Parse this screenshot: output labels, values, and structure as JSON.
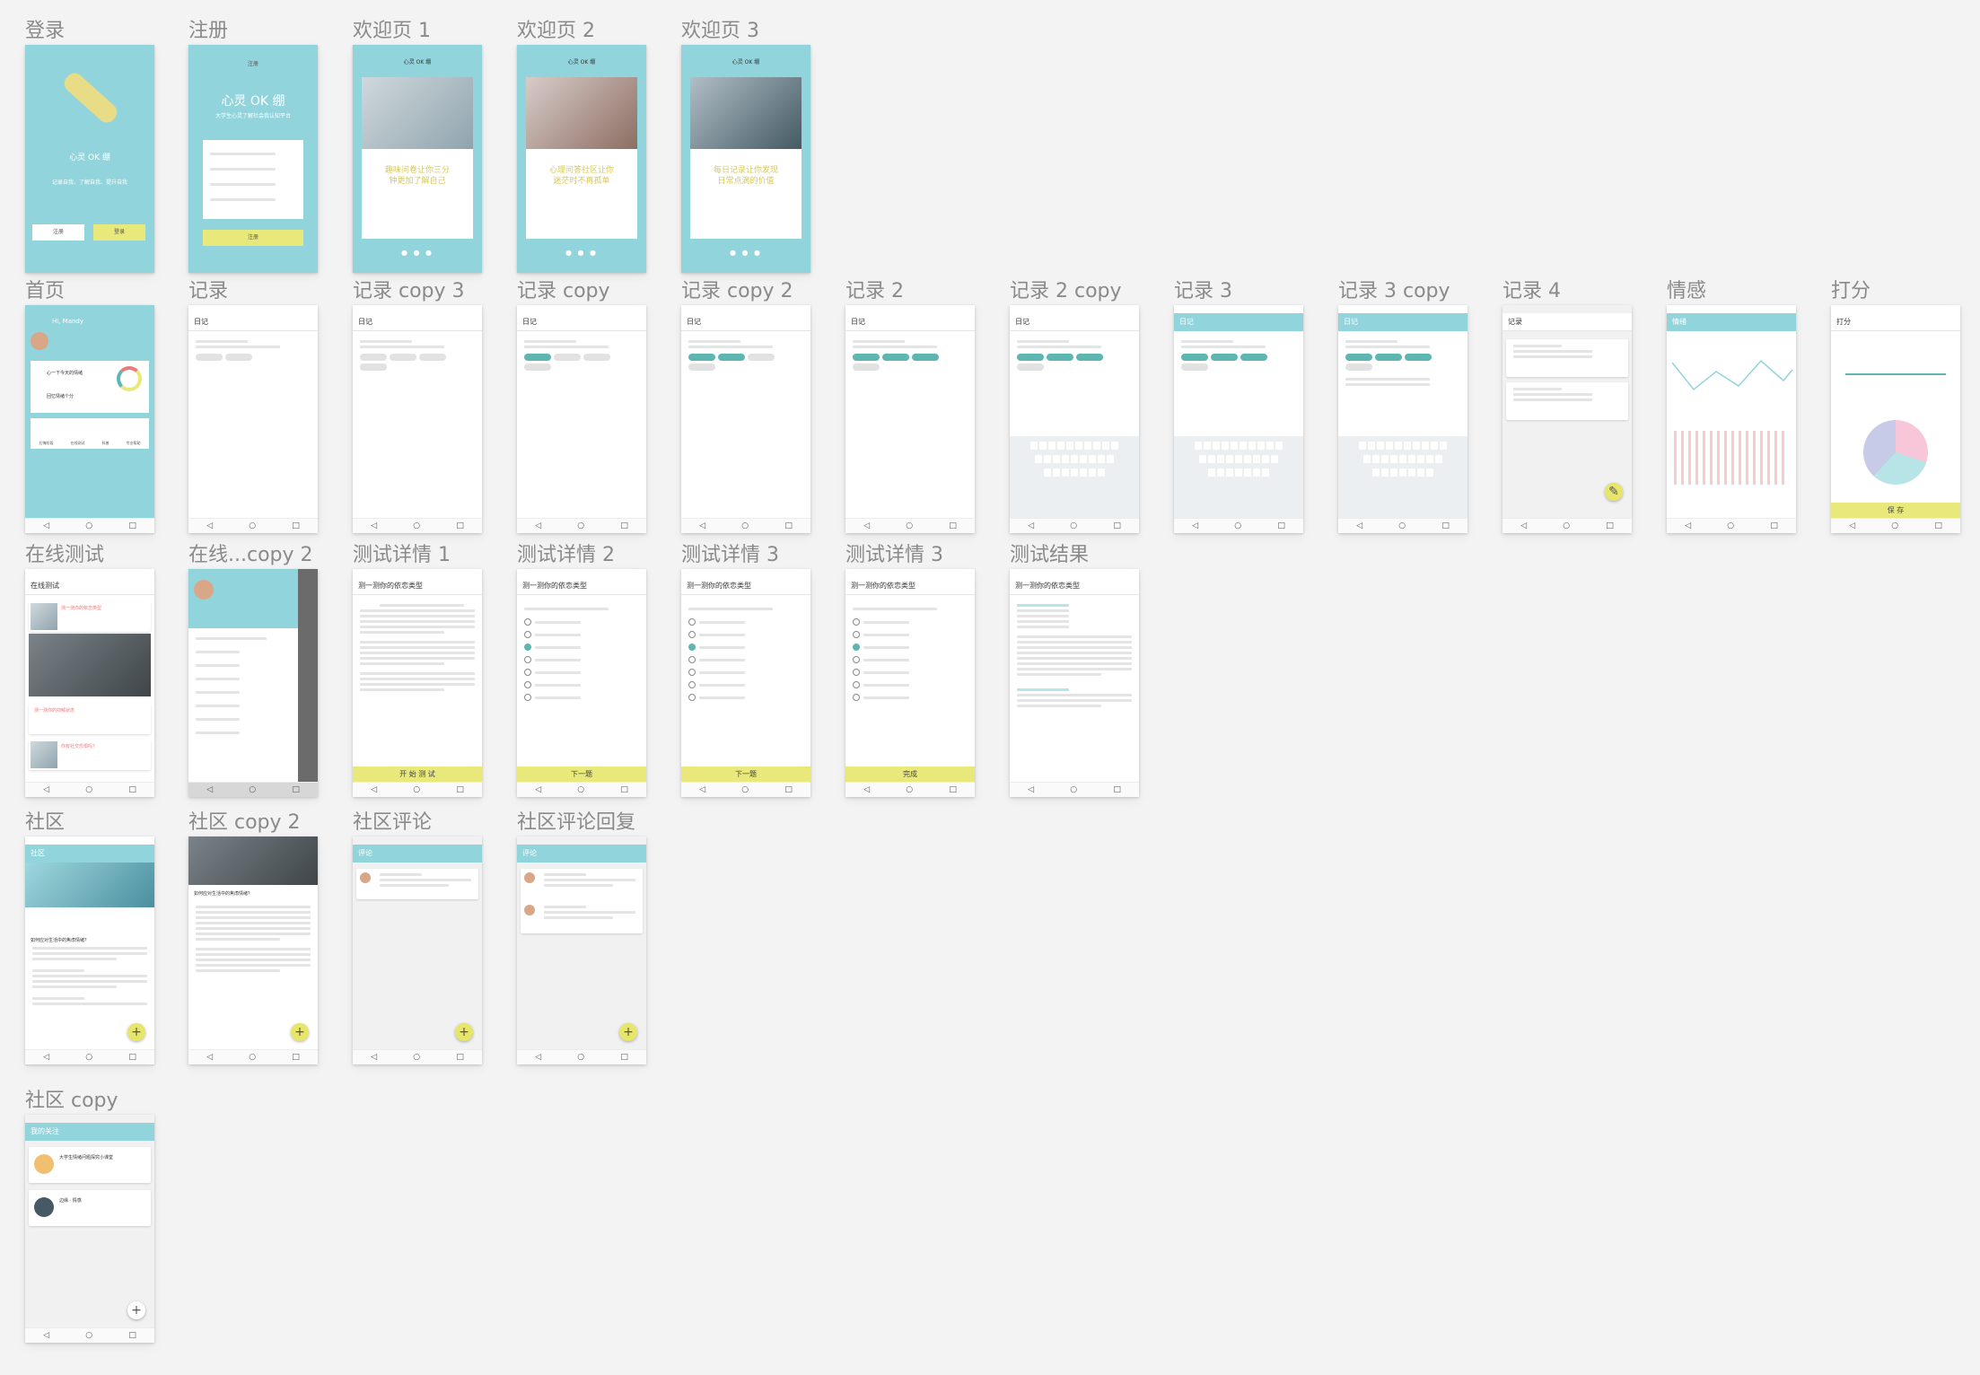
{
  "boards": {
    "login": "登录",
    "signup": "注册",
    "welcome1": "欢迎页 1",
    "welcome2": "欢迎页 2",
    "welcome3": "欢迎页 3",
    "home": "首页",
    "record": "记录",
    "record_copy3": "记录 copy 3",
    "record_copy": "记录 copy",
    "record_copy2": "记录 copy 2",
    "record2": "记录 2",
    "record2_copy": "记录 2 copy",
    "record3": "记录 3",
    "record3_copy": "记录 3 copy",
    "record4": "记录 4",
    "emotion": "情感",
    "rating": "打分",
    "online_test": "在线测试",
    "online_test_copy2": "在线...copy 2",
    "test_detail1": "测试详情 1",
    "test_detail2": "测试详情 2",
    "test_detail3a": "测试详情 3",
    "test_detail3b": "测试详情 3",
    "test_result": "测试结果",
    "community": "社区",
    "community_copy2": "社区 copy 2",
    "community_comment": "社区评论",
    "community_reply": "社区评论回复",
    "community_copy": "社区 copy"
  },
  "login": {
    "app_name": "心灵 OK 绷",
    "slogan": "记录自我、了解自我、提升自我",
    "btn_signup": "注册",
    "btn_login": "登录"
  },
  "signup": {
    "header": "注册",
    "title": "心灵 OK 绷",
    "subtitle": "大学生心灵了解社会我认知平台",
    "btn": "注册"
  },
  "welcome": {
    "header": "心灵 OK 绷",
    "w1": "趣味问卷让你三分\n钟更加了解自己",
    "w2": "心理问答社区让你\n迷茫时不再孤单",
    "w3": "每日记录让你发现\n日常点滴的价值",
    "dots": "● ● ●"
  },
  "home": {
    "greeting": "Hi, Mandy",
    "item1": "心一下今天的情绪",
    "item2": "回忆情绪个分",
    "chart_label": "本周心情记录",
    "grid": [
      "后悔阶段",
      "在线测试",
      "科普",
      "专业帮助"
    ]
  },
  "record": {
    "title": "日记",
    "title2": "记录"
  },
  "emotion": {
    "title": "情绪"
  },
  "rating": {
    "title": "打分",
    "save": "保 存"
  },
  "tests": {
    "list_title": "在线测试",
    "item1": "测一测你的依恋类型",
    "item2": "测一测你的抑郁状态",
    "item3": "你有社交恐惧吗？",
    "test_title": "测一测你的依恋类型",
    "start": "开 始 测 试",
    "next": "下一题",
    "done": "完成"
  },
  "community": {
    "title": "社区",
    "post1": "如何应对生活中的焦虑情绪？",
    "comment_title": "评论",
    "my_follow": "我的关注",
    "follow1": "大学生情绪问题探究小课堂",
    "follow2": "边缘 · 情感"
  }
}
